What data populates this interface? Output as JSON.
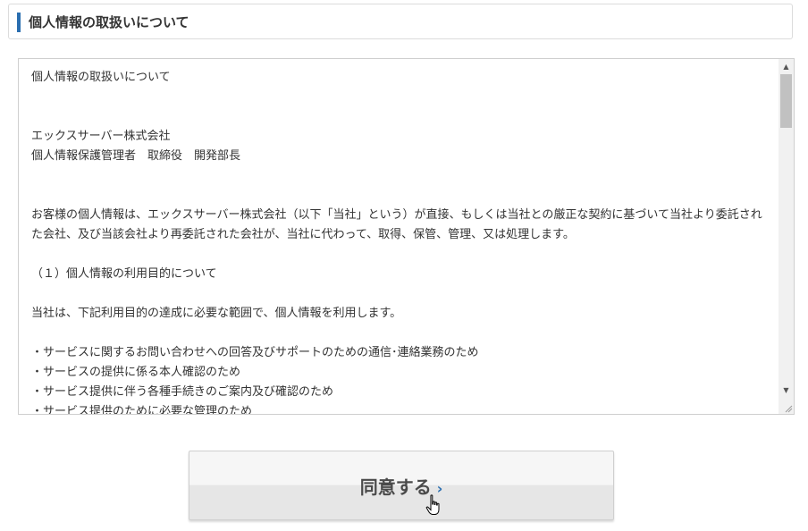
{
  "header": {
    "title": "個人情報の取扱いについて"
  },
  "policy": {
    "lines": [
      "個人情報の取扱いについて",
      "",
      "",
      "エックスサーバー株式会社",
      "個人情報保護管理者　取締役　開発部長",
      "",
      "",
      "お客様の個人情報は、エックスサーバー株式会社（以下「当社」という）が直接、もしくは当社との厳正な契約に基づいて当社より委託された会社、及び当該会社より再委託された会社が、当社に代わって、取得、保管、管理、又は処理します。",
      "",
      "（１）個人情報の利用目的について",
      "",
      "当社は、下記利用目的の達成に必要な範囲で、個人情報を利用します。",
      "",
      "・サービスに関するお問い合わせへの回答及びサポートのための通信･連絡業務のため",
      "・サービスの提供に係る本人確認のため",
      "・サービス提供に伴う各種手続きのご案内及び確認のため",
      "・サービス提供のために必要な管理のため"
    ]
  },
  "agree_button": {
    "label": "同意する",
    "chevron": "›"
  },
  "icons": {
    "scroll_up": "▲",
    "scroll_down": "▼",
    "cursor": "hand-pointer-icon"
  }
}
